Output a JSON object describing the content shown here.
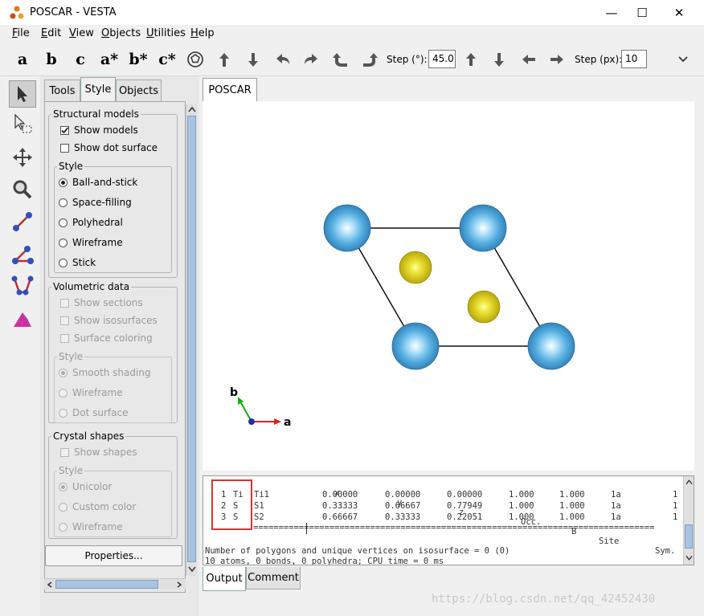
{
  "window": {
    "title": "POSCAR - VESTA",
    "minimize": "—",
    "maximize": "☐",
    "close": "✕"
  },
  "menu": [
    {
      "key": "F",
      "rest": "ile"
    },
    {
      "key": "E",
      "rest": "dit"
    },
    {
      "key": "V",
      "rest": "iew"
    },
    {
      "key": "O",
      "rest": "bjects"
    },
    {
      "key": "U",
      "rest": "tilities"
    },
    {
      "key": "H",
      "rest": "elp"
    }
  ],
  "toolbar": {
    "a": "a",
    "b": "b",
    "c": "c",
    "as": "a*",
    "bs": "b*",
    "cs": "c*",
    "step_deg_label": "Step (°):",
    "step_deg": "45.0",
    "step_px_label": "Step (px):",
    "step_px": "10"
  },
  "panel": {
    "tabs": [
      "Tools",
      "Style",
      "Objects"
    ],
    "structural": {
      "title": "Structural models",
      "show_models": "Show models",
      "show_dot": "Show dot surface",
      "style_title": "Style",
      "styles": [
        "Ball-and-stick",
        "Space-filling",
        "Polyhedral",
        "Wireframe",
        "Stick"
      ]
    },
    "volumetric": {
      "title": "Volumetric data",
      "items": [
        "Show sections",
        "Show isosurfaces",
        "Surface coloring"
      ],
      "style_title": "Style",
      "styles": [
        "Smooth shading",
        "Wireframe",
        "Dot surface"
      ]
    },
    "crystal": {
      "title": "Crystal shapes",
      "show": "Show shapes",
      "style_title": "Style",
      "styles": [
        "Unicolor",
        "Custom color",
        "Wireframe"
      ]
    },
    "properties": "Properties..."
  },
  "doc_tab": "POSCAR",
  "axes": {
    "a": "a",
    "b": "b"
  },
  "output": {
    "header": {
      "x": "x",
      "y": "y",
      "z": "z",
      "occ": "Occ.",
      "b": "B",
      "site": "Site",
      "sym": "Sym."
    },
    "rows": [
      {
        "n": "1",
        "el": "Ti",
        "label": "Ti1",
        "x": "0.00000",
        "y": "0.00000",
        "z": "0.00000",
        "occ": "1.000",
        "b": "1.000",
        "site": "1a",
        "sym": "1"
      },
      {
        "n": "2",
        "el": "S",
        "label": "S1",
        "x": "0.33333",
        "y": "0.66667",
        "z": "0.77949",
        "occ": "1.000",
        "b": "1.000",
        "site": "1a",
        "sym": "1"
      },
      {
        "n": "3",
        "el": "S",
        "label": "S2",
        "x": "0.66667",
        "y": "0.33333",
        "z": "0.22051",
        "occ": "1.000",
        "b": "1.000",
        "site": "1a",
        "sym": "1"
      }
    ],
    "separator": "===============================================================================",
    "line1": "Number of polygons and unique vertices on isosurface = 0 (0)",
    "line2": "10 atoms, 0 bonds, 0 polyhedra; CPU time = 0 ms"
  },
  "out_tabs": [
    "Output",
    "Comment"
  ],
  "watermark": "https://blog.csdn.net/qq_42452430",
  "colors": {
    "ti": "#4aa3dc",
    "s": "#e6d41a",
    "highlight": "#e03030"
  }
}
